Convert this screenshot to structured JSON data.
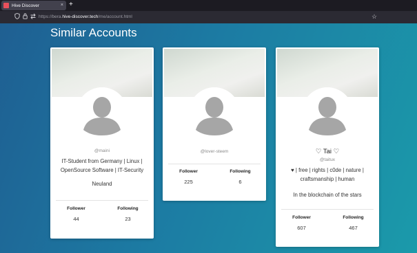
{
  "browser": {
    "tab_title": "Hive Discover",
    "tab_close": "×",
    "new_tab": "+",
    "url_prefix": "https://bera.",
    "url_host": "hive-discover.tech",
    "url_path": "/me/account.html"
  },
  "page": {
    "title": "Similar Accounts"
  },
  "accounts": [
    {
      "display_name": "",
      "handle": "@maini",
      "about": "IT-Student from Germany | Linux | OpenSource Software | IT-Security",
      "location": "Neuland",
      "follower_label": "Follower",
      "follower_count": "44",
      "following_label": "Following",
      "following_count": "23"
    },
    {
      "display_name": "",
      "handle": "@lover-steem",
      "about": "",
      "location": "",
      "follower_label": "Follower",
      "follower_count": "225",
      "following_label": "Following",
      "following_count": "6"
    },
    {
      "display_name": "♡ Tai ♡",
      "handle": "@taitux",
      "about": "♥ | free | rights | c0de | nature | craftsmanship | human",
      "location": "In the blockchain of the stars",
      "follower_label": "Follower",
      "follower_count": "607",
      "following_label": "Following",
      "following_count": "467"
    }
  ]
}
